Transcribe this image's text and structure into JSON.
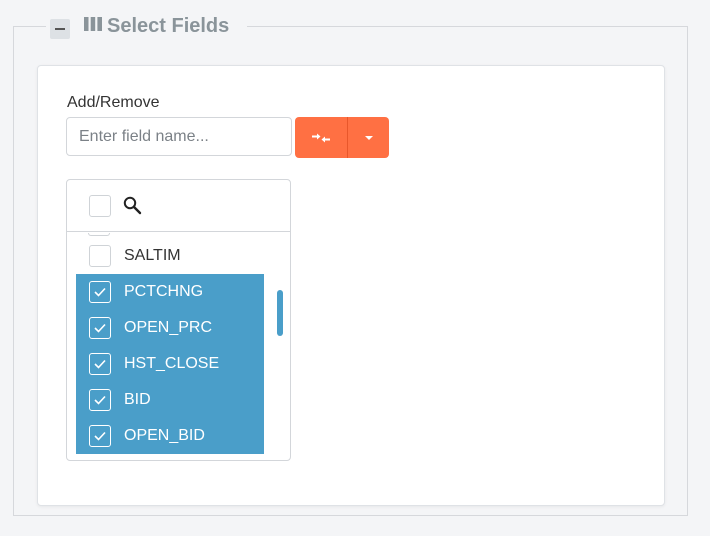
{
  "section": {
    "title": "Select Fields",
    "collapse_icon": "minus-icon",
    "title_icon": "columns-icon"
  },
  "add_remove": {
    "label": "Add/Remove",
    "input_placeholder": "Enter field name...",
    "input_value": "",
    "swap_icon": "swap-arrows-icon",
    "dropdown_icon": "caret-down-icon",
    "accent": "#ff7043"
  },
  "field_list": {
    "search_icon": "search-icon",
    "selected_color": "#4a9ec9",
    "items": [
      {
        "label": "SALTIM",
        "checked": false
      },
      {
        "label": "PCTCHNG",
        "checked": true
      },
      {
        "label": "OPEN_PRC",
        "checked": true
      },
      {
        "label": "HST_CLOSE",
        "checked": true
      },
      {
        "label": "BID",
        "checked": true
      },
      {
        "label": "OPEN_BID",
        "checked": true
      }
    ]
  }
}
